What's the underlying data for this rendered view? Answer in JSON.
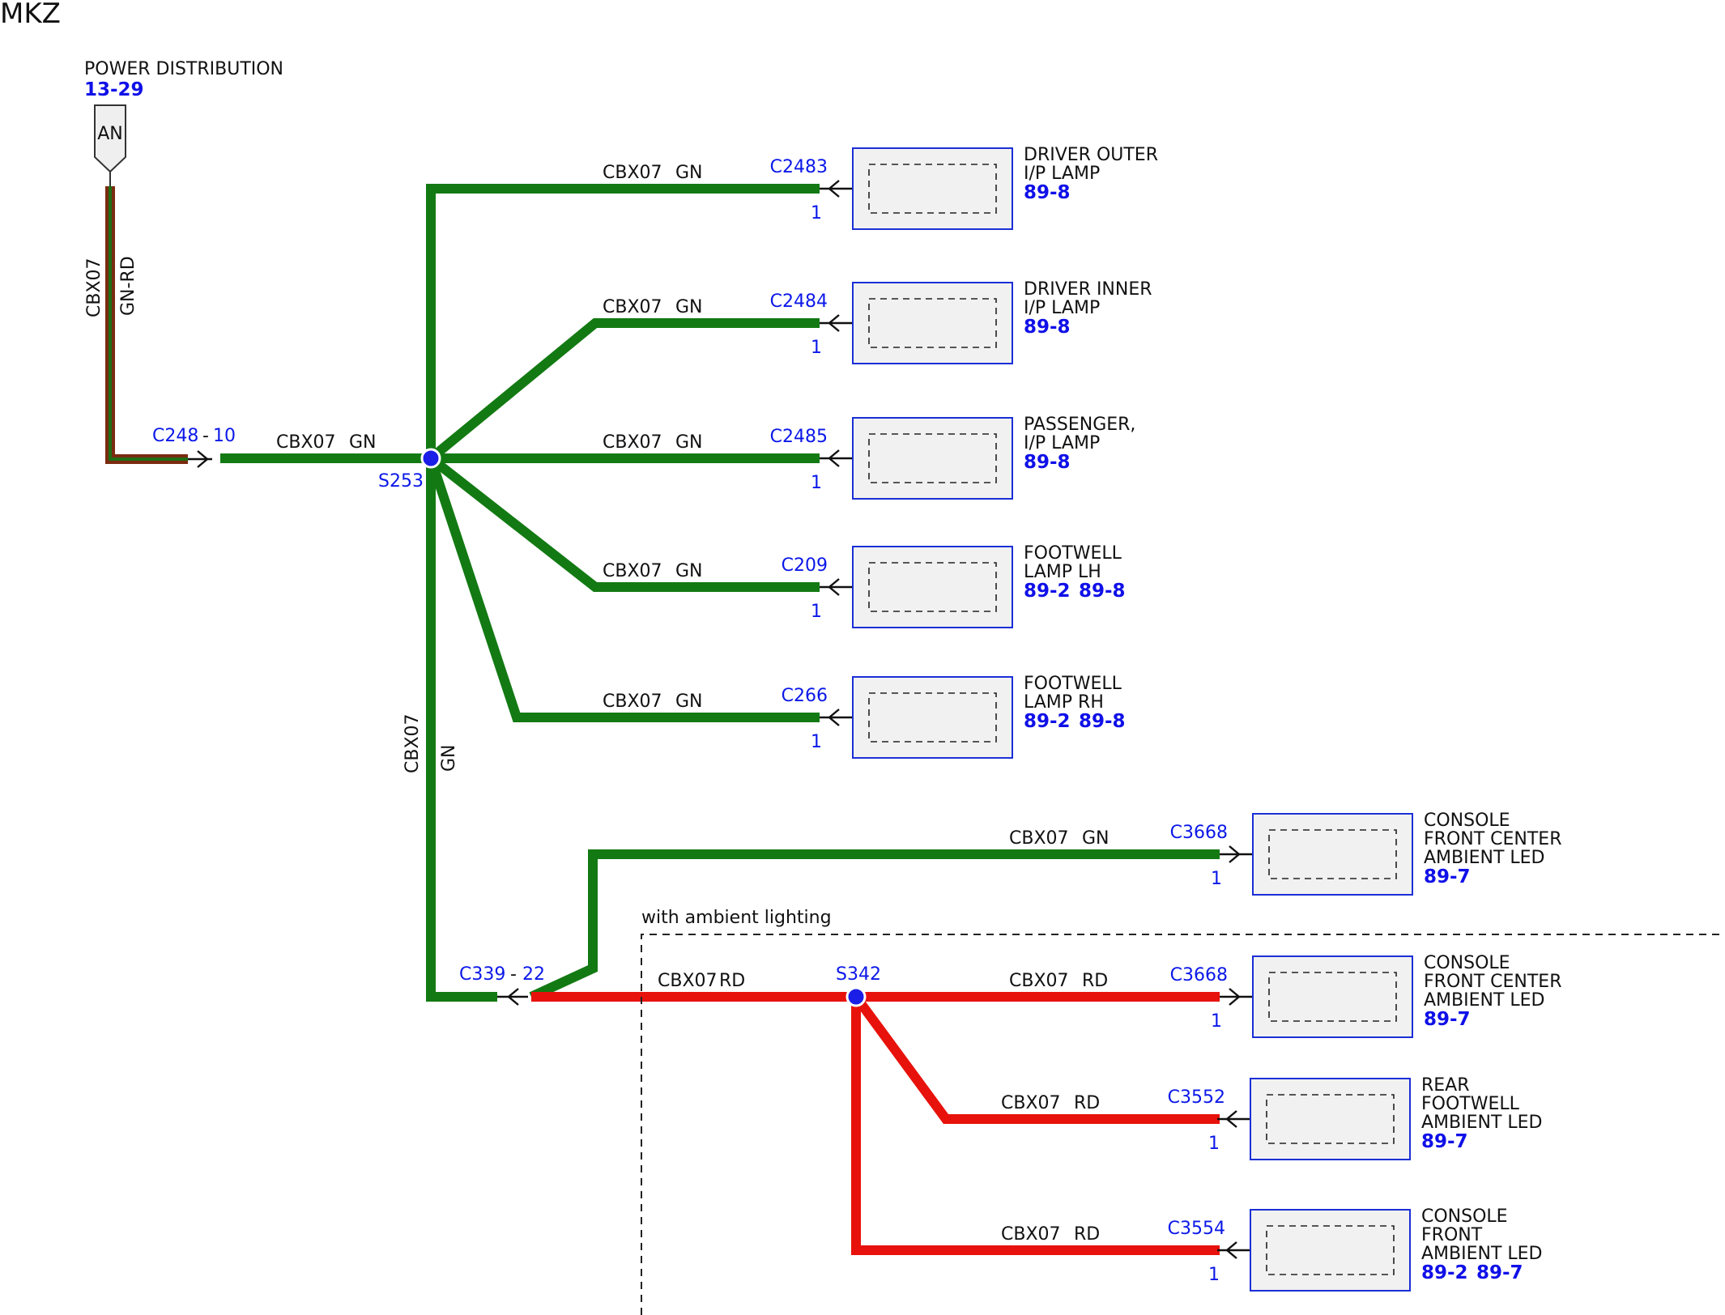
{
  "title": "MKZ",
  "power": {
    "label": "POWER DISTRIBUTION",
    "page": "13-29",
    "fuse": "AN"
  },
  "feed": {
    "circuit": "CBX07",
    "color": "GN-RD"
  },
  "c248": {
    "ref": "C248",
    "dash": "-",
    "pin": "10"
  },
  "main_wire": {
    "circuit": "CBX07",
    "color": "GN"
  },
  "s253": "S253",
  "trunk": {
    "circuit": "CBX07",
    "color": "GN"
  },
  "c339": {
    "ref": "C339",
    "dash": "-",
    "pin": "22"
  },
  "s342": "S342",
  "ambient_label": "with ambient lighting",
  "red_wire": {
    "circuit": "CBX07",
    "color": "RD"
  },
  "branches": [
    {
      "circuit": "CBX07",
      "color": "GN",
      "connector": "C2483",
      "pin": "1",
      "name": [
        "DRIVER OUTER",
        "I/P LAMP"
      ],
      "pages": [
        "89-8"
      ]
    },
    {
      "circuit": "CBX07",
      "color": "GN",
      "connector": "C2484",
      "pin": "1",
      "name": [
        "DRIVER INNER",
        "I/P LAMP"
      ],
      "pages": [
        "89-8"
      ]
    },
    {
      "circuit": "CBX07",
      "color": "GN",
      "connector": "C2485",
      "pin": "1",
      "name": [
        "PASSENGER,",
        "I/P LAMP"
      ],
      "pages": [
        "89-8"
      ]
    },
    {
      "circuit": "CBX07",
      "color": "GN",
      "connector": "C209",
      "pin": "1",
      "name": [
        "FOOTWELL",
        "LAMP LH"
      ],
      "pages": [
        "89-2",
        "89-8"
      ]
    },
    {
      "circuit": "CBX07",
      "color": "GN",
      "connector": "C266",
      "pin": "1",
      "name": [
        "FOOTWELL",
        "LAMP RH"
      ],
      "pages": [
        "89-2",
        "89-8"
      ]
    },
    {
      "circuit": "CBX07",
      "color": "GN",
      "connector": "C3668",
      "pin": "1",
      "name": [
        "CONSOLE",
        "FRONT CENTER",
        "AMBIENT LED"
      ],
      "pages": [
        "89-7"
      ]
    },
    {
      "circuit": "CBX07",
      "color": "RD",
      "connector": "C3668",
      "pin": "1",
      "name": [
        "CONSOLE",
        "FRONT CENTER",
        "AMBIENT LED"
      ],
      "pages": [
        "89-7"
      ]
    },
    {
      "circuit": "CBX07",
      "color": "RD",
      "connector": "C3552",
      "pin": "1",
      "name": [
        "REAR",
        "FOOTWELL",
        "AMBIENT LED"
      ],
      "pages": [
        "89-7"
      ]
    },
    {
      "circuit": "CBX07",
      "color": "RD",
      "connector": "C3554",
      "pin": "1",
      "name": [
        "CONSOLE",
        "FRONT",
        "AMBIENT LED"
      ],
      "pages": [
        "89-2",
        "89-7"
      ]
    }
  ]
}
